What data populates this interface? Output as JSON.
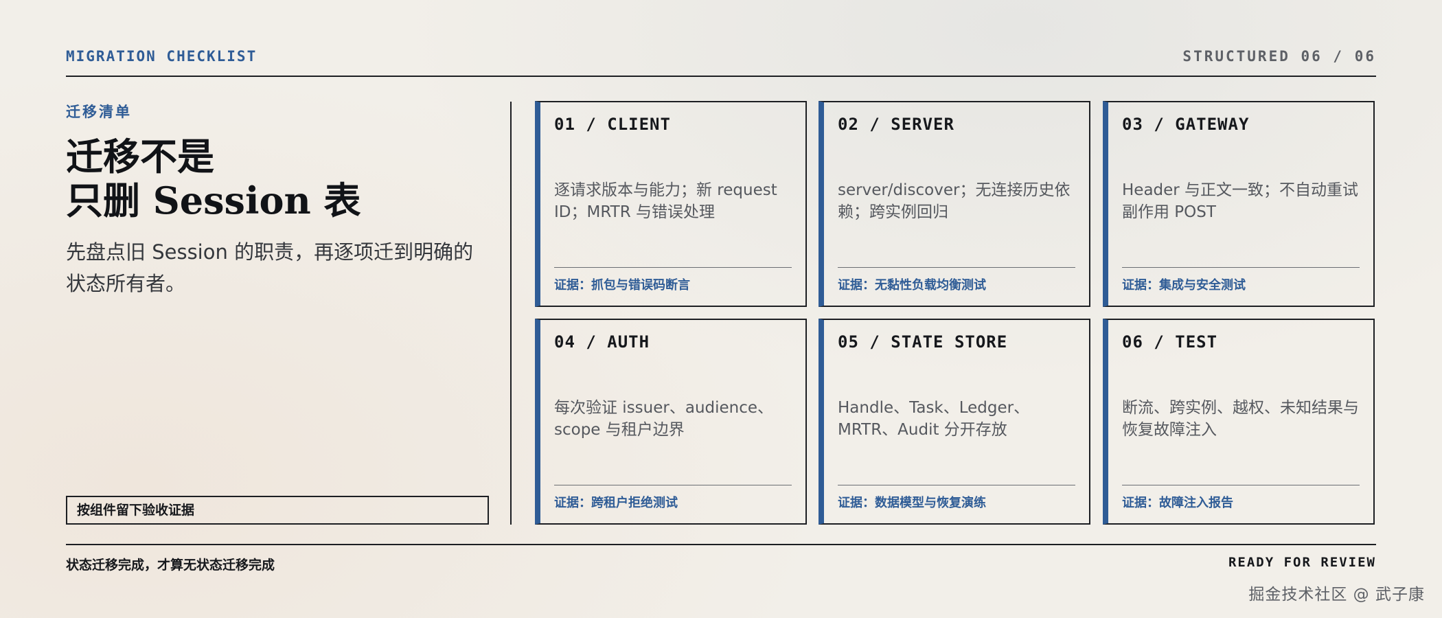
{
  "header": {
    "left_label": "MIGRATION CHECKLIST",
    "right_label": "STRUCTURED 06 / 06"
  },
  "hero": {
    "eyebrow": "迁移清单",
    "title_lines": [
      "迁移不是",
      "只删 Session 表"
    ],
    "subtitle": "先盘点旧 Session 的职责，再逐项迁到明确的状态所有者。",
    "evidence_box": "按组件留下验收证据"
  },
  "cards": [
    {
      "title": "01 / CLIENT",
      "description": "逐请求版本与能力；新 request ID；MRTR 与错误处理",
      "evidence": "证据：抓包与错误码断言"
    },
    {
      "title": "02 / SERVER",
      "description": "server/discover；无连接历史依赖；跨实例回归",
      "evidence": "证据：无黏性负载均衡测试"
    },
    {
      "title": "03 / GATEWAY",
      "description": "Header 与正文一致；不自动重试副作用 POST",
      "evidence": "证据：集成与安全测试"
    },
    {
      "title": "04 / AUTH",
      "description": "每次验证 issuer、audience、scope 与租户边界",
      "evidence": "证据：跨租户拒绝测试"
    },
    {
      "title": "05 / STATE STORE",
      "description": "Handle、Task、Ledger、MRTR、Audit 分开存放",
      "evidence": "证据：数据模型与恢复演练"
    },
    {
      "title": "06 / TEST",
      "description": "断流、跨实例、越权、未知结果与恢复故障注入",
      "evidence": "证据：故障注入报告"
    }
  ],
  "footer": {
    "left": "状态迁移完成，才算无状态迁移完成",
    "right": "READY FOR REVIEW"
  },
  "watermark": "掘金技术社区 @ 武子康",
  "colors": {
    "accent": "#2f5c96",
    "ink": "#16181c",
    "background": "#f2efe9",
    "muted": "#55585e"
  }
}
